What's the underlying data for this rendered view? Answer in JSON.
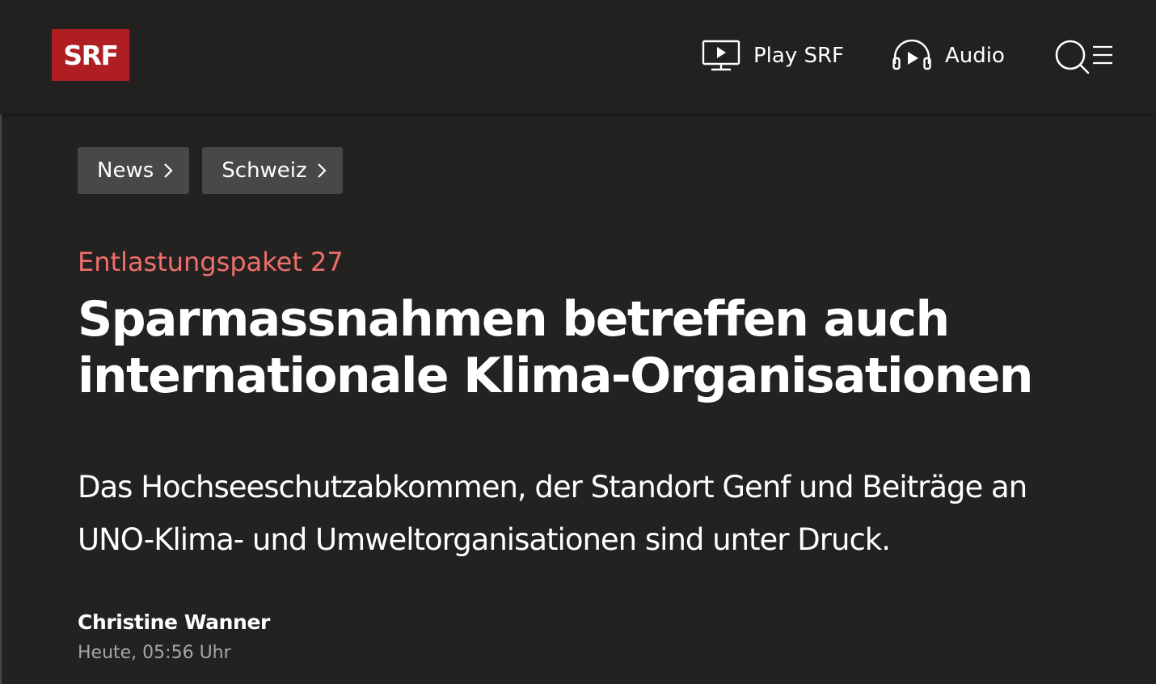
{
  "header": {
    "logo_text": "SRF",
    "nav": {
      "play_label": "Play SRF",
      "audio_label": "Audio"
    },
    "search_icon": "search-icon",
    "menu_icon": "hamburger-menu-icon"
  },
  "breadcrumbs": [
    {
      "label": "News"
    },
    {
      "label": "Schweiz"
    }
  ],
  "article": {
    "kicker": "Entlastungspaket 27",
    "title": "Sparmassnahmen betreffen auch internationale Klima-Organisationen",
    "lead": "Das Hochseeschutzabkommen, der Standort Genf und Beiträge an UNO-Klima- und Umweltorganisationen sind unter Druck.",
    "author": "Christine Wanner",
    "date": "Heute, 05:56 Uhr"
  },
  "colors": {
    "background": "#242220",
    "logo_red": "#af1e23",
    "kicker_red": "#ee6f6b",
    "breadcrumb_bg": "#4a4846",
    "date_grey": "#a8a6a4"
  }
}
